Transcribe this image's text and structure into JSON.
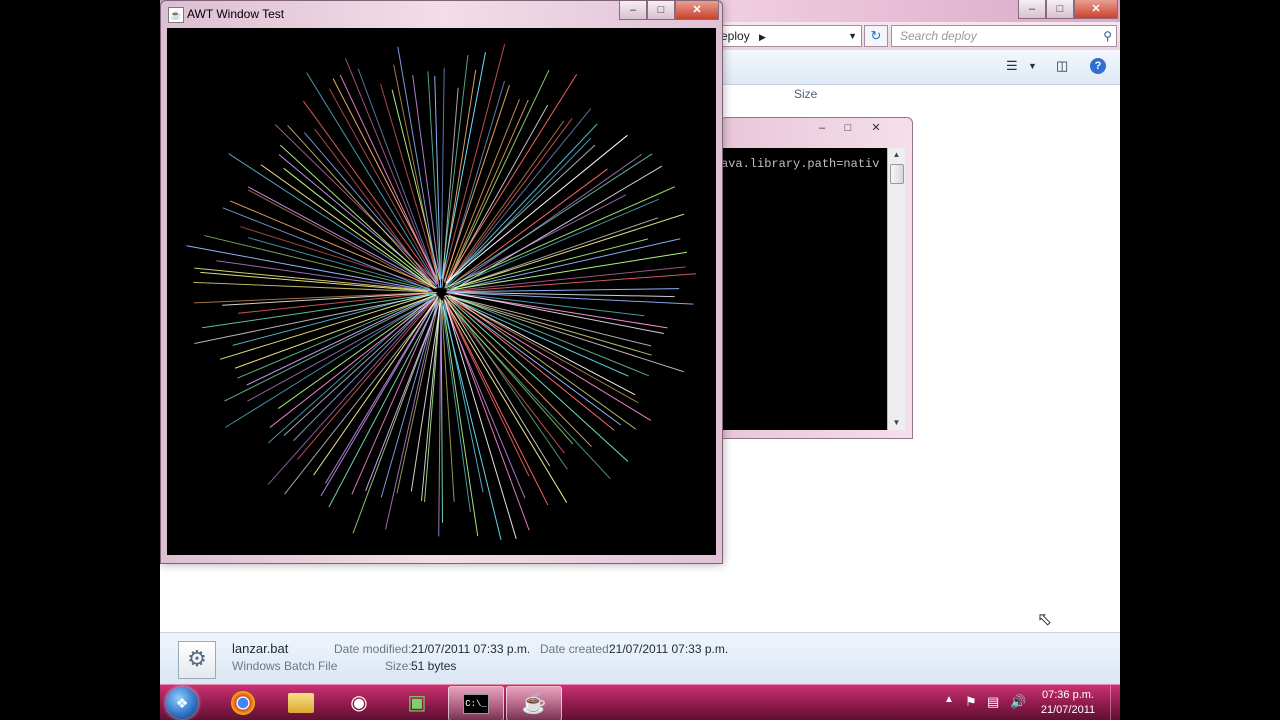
{
  "explorer": {
    "address_crumb": "eploy",
    "search_placeholder": "Search deploy",
    "column_header": "Size",
    "details": {
      "file_name": "lanzar.bat",
      "file_type": "Windows Batch File",
      "date_modified_label": "Date modified:",
      "date_modified": "21/07/2011 07:33 p.m.",
      "date_created_label": "Date created:",
      "date_created": "21/07/2011 07:33 p.m.",
      "size_label": "Size:",
      "size": "51 bytes"
    }
  },
  "console": {
    "text": "ava.library.path=nativ"
  },
  "awt_window": {
    "title": "AWT Window Test"
  },
  "taskbar": {
    "apps": [
      "windows-start",
      "chrome",
      "file-explorer",
      "media-player",
      "app-green",
      "command-prompt",
      "java"
    ],
    "clock_time": "07:36 p.m.",
    "clock_date": "21/07/2011"
  },
  "colors": {
    "taskbar": "#8e1a4b",
    "accent_pink": "#e3b6cf",
    "canvas_bg": "#000000"
  }
}
